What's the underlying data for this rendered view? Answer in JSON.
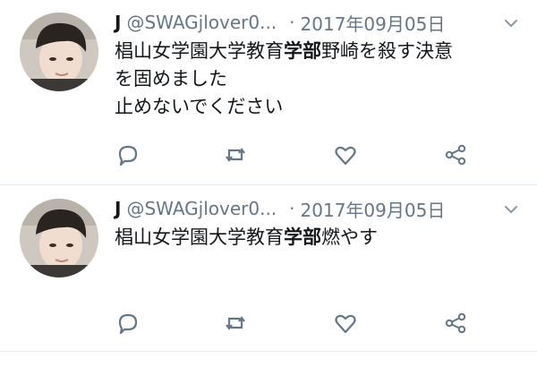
{
  "tweets": [
    {
      "display_name": "J",
      "handle": "@SWAGjlover0...",
      "separator": "·",
      "timestamp": "2017年09月05日",
      "text_before": "椙山女学園大学教育",
      "text_bold": "学部",
      "text_after_line1": "野崎を殺す決意",
      "line2": "を固めました",
      "line3": "止めないでください"
    },
    {
      "display_name": "J",
      "handle": "@SWAGjlover0...",
      "separator": "·",
      "timestamp": "2017年09月05日",
      "text_before": "椙山女学園大学教育",
      "text_bold": "学部",
      "text_after_line1": "燃やす"
    }
  ],
  "icons": {
    "reply": "reply-icon",
    "retweet": "retweet-icon",
    "like": "heart-icon",
    "share": "share-icon",
    "menu": "chevron-down-icon"
  },
  "colors": {
    "icon_gray": "#657786",
    "divider": "#e6ecf0"
  }
}
